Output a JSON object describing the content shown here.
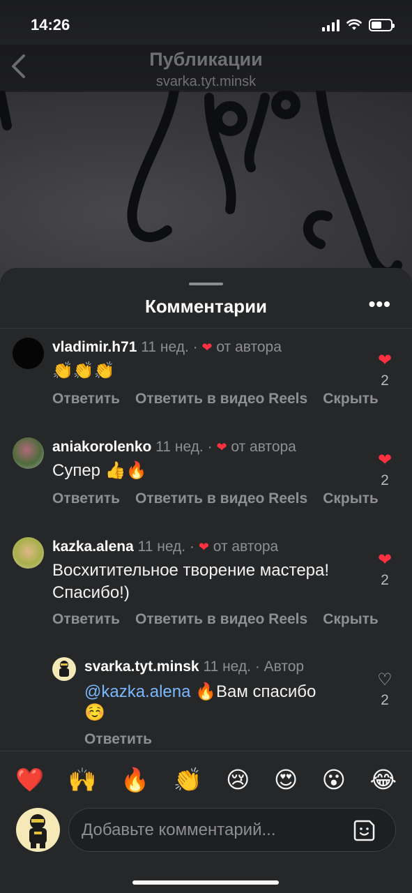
{
  "status": {
    "time": "14:26"
  },
  "header": {
    "title": "Публикации",
    "subtitle": "svarka.tyt.minsk"
  },
  "sheet": {
    "title": "Комментарии",
    "more_label": "•••"
  },
  "comments": [
    {
      "user": "vladimir.h71",
      "meta": "11 нед. ·",
      "author_like": "от автора",
      "text": "👏👏👏",
      "actions": [
        "Ответить",
        "Ответить в видео Reels",
        "Скрыть"
      ],
      "likes": "2"
    },
    {
      "user": "aniakorolenko",
      "meta": "11 нед. ·",
      "author_like": "от автора",
      "text": "Супер 👍🔥",
      "actions": [
        "Ответить",
        "Ответить в видео Reels",
        "Скрыть"
      ],
      "likes": "2"
    },
    {
      "user": "kazka.alena",
      "meta": "11 нед. ·",
      "author_like": "от автора",
      "text_line1": "Восхитительное творение мастера!",
      "text_line2": "Спасибо!)",
      "actions": [
        "Ответить",
        "Ответить в видео Reels",
        "Скрыть"
      ],
      "likes": "2"
    },
    {
      "user": "svarka.tyt.minsk",
      "meta": "11 нед. · Автор",
      "mention": "@kazka.alena",
      "text_line1": "🔥Вам спасибо",
      "text_line2": "☺️",
      "actions": [
        "Ответить"
      ],
      "likes": "2"
    }
  ],
  "reactions": [
    "❤️",
    "🙌",
    "🔥",
    "👏",
    "😢",
    "😍",
    "😮",
    "😂"
  ],
  "composer": {
    "placeholder": "Добавьте комментарий..."
  }
}
